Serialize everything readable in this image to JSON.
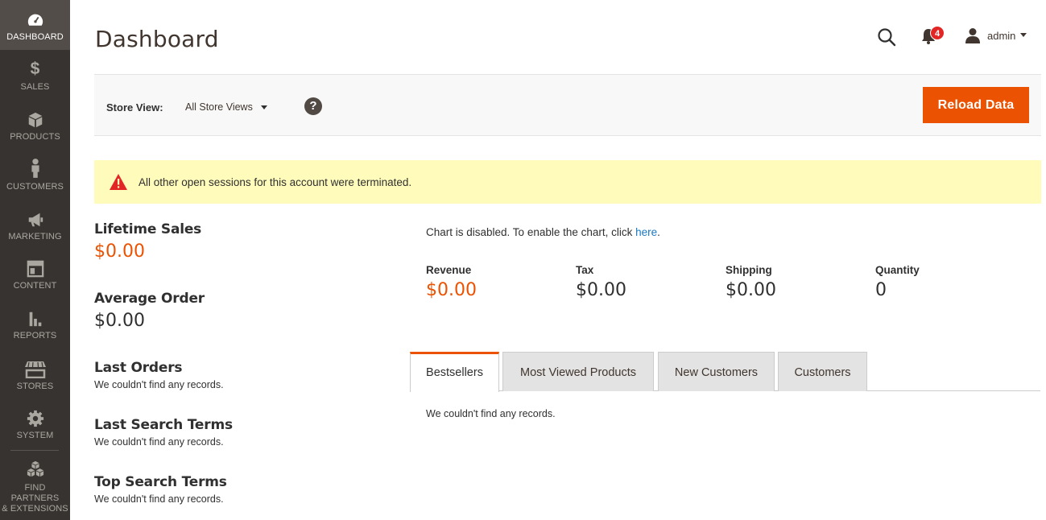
{
  "sidebar": {
    "items": [
      {
        "label": "DASHBOARD",
        "icon": "dashboard-icon"
      },
      {
        "label": "SALES",
        "icon": "dollar-icon"
      },
      {
        "label": "PRODUCTS",
        "icon": "box-icon"
      },
      {
        "label": "CUSTOMERS",
        "icon": "person-icon"
      },
      {
        "label": "MARKETING",
        "icon": "megaphone-icon"
      },
      {
        "label": "CONTENT",
        "icon": "layout-icon"
      },
      {
        "label": "REPORTS",
        "icon": "bar-chart-icon"
      },
      {
        "label": "STORES",
        "icon": "store-icon"
      },
      {
        "label": "SYSTEM",
        "icon": "gear-icon"
      },
      {
        "label_line1": "FIND PARTNERS",
        "label_line2": "& EXTENSIONS",
        "icon": "cubes-icon"
      }
    ]
  },
  "header": {
    "title": "Dashboard",
    "notification_count": "4",
    "user_name": "admin"
  },
  "store_bar": {
    "label": "Store View:",
    "selected": "All Store Views",
    "help": "?",
    "reload_label": "Reload Data"
  },
  "notice": {
    "text": "All other open sessions for this account were terminated."
  },
  "stats": {
    "lifetime_sales_label": "Lifetime Sales",
    "lifetime_sales_value": "$0.00",
    "average_order_label": "Average Order",
    "average_order_value": "$0.00"
  },
  "blocks": {
    "last_orders_title": "Last Orders",
    "last_orders_empty": "We couldn't find any records.",
    "last_search_title": "Last Search Terms",
    "last_search_empty": "We couldn't find any records.",
    "top_search_title": "Top Search Terms",
    "top_search_empty": "We couldn't find any records."
  },
  "chart": {
    "message_prefix": "Chart is disabled. To enable the chart, click ",
    "link_text": "here",
    "message_suffix": "."
  },
  "totals": {
    "revenue_label": "Revenue",
    "revenue_value": "$0.00",
    "tax_label": "Tax",
    "tax_value": "$0.00",
    "shipping_label": "Shipping",
    "shipping_value": "$0.00",
    "quantity_label": "Quantity",
    "quantity_value": "0"
  },
  "tabs": {
    "items": [
      "Bestsellers",
      "Most Viewed Products",
      "New Customers",
      "Customers"
    ],
    "empty": "We couldn't find any records."
  },
  "colors": {
    "sidebar_bg": "#373330",
    "accent": "#eb5202",
    "notice_bg": "#fffbbb",
    "link": "#1979c3"
  }
}
